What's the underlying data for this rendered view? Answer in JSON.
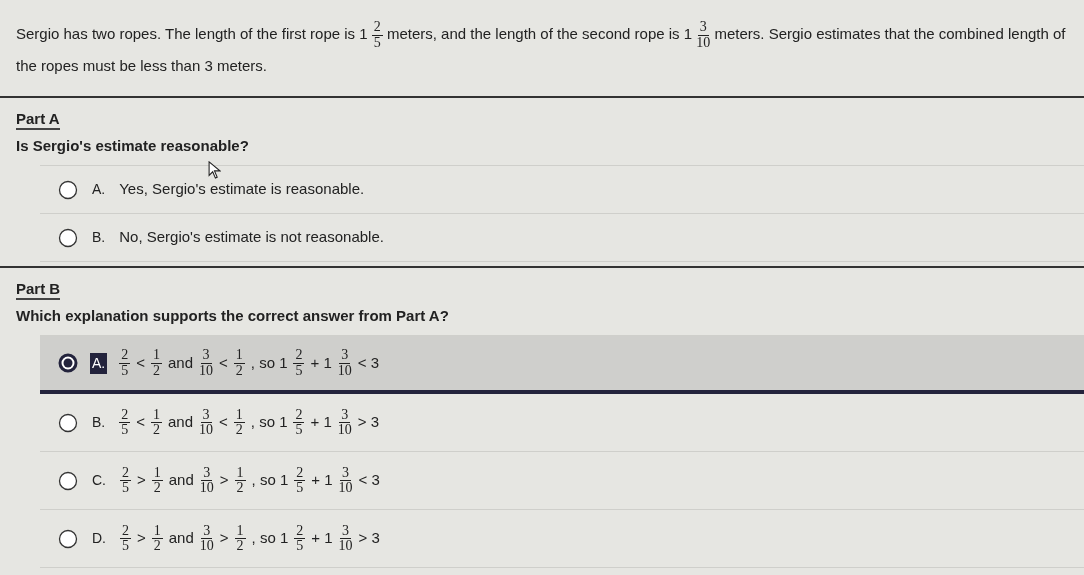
{
  "stem": [
    {
      "kind": "text",
      "text": "Sergio has two ropes. The length of the first rope is"
    },
    {
      "kind": "text",
      "text": "1"
    },
    {
      "kind": "frac",
      "num": "2",
      "den": "5"
    },
    {
      "kind": "text",
      "text": "meters, and the length of the second rope is"
    },
    {
      "kind": "text",
      "text": "1"
    },
    {
      "kind": "frac",
      "num": "3",
      "den": "10"
    },
    {
      "kind": "text",
      "text": "meters. Sergio estimates that the combined length of the ropes must be less than 3 meters."
    }
  ],
  "parts": [
    {
      "title": "Part A",
      "prompt": "Is Sergio's estimate reasonable?",
      "options": [
        {
          "letter": "A.",
          "selected": false,
          "content": [
            {
              "kind": "text",
              "text": "Yes, Sergio's estimate is reasonable."
            }
          ]
        },
        {
          "letter": "B.",
          "selected": false,
          "content": [
            {
              "kind": "text",
              "text": "No, Sergio's estimate is not reasonable."
            }
          ]
        }
      ]
    },
    {
      "title": "Part B",
      "prompt": "Which explanation supports the correct answer from Part A?",
      "options": [
        {
          "letter": "A.",
          "selected": true,
          "content": [
            {
              "kind": "frac",
              "num": "2",
              "den": "5"
            },
            {
              "kind": "text",
              "text": "<"
            },
            {
              "kind": "frac",
              "num": "1",
              "den": "2"
            },
            {
              "kind": "text",
              "text": "and"
            },
            {
              "kind": "frac",
              "num": "3",
              "den": "10"
            },
            {
              "kind": "text",
              "text": "<"
            },
            {
              "kind": "frac",
              "num": "1",
              "den": "2"
            },
            {
              "kind": "text",
              "text": ", so 1"
            },
            {
              "kind": "frac",
              "num": "2",
              "den": "5"
            },
            {
              "kind": "text",
              "text": "+ 1"
            },
            {
              "kind": "frac",
              "num": "3",
              "den": "10"
            },
            {
              "kind": "text",
              "text": "< 3"
            }
          ]
        },
        {
          "letter": "B.",
          "selected": false,
          "content": [
            {
              "kind": "frac",
              "num": "2",
              "den": "5"
            },
            {
              "kind": "text",
              "text": "<"
            },
            {
              "kind": "frac",
              "num": "1",
              "den": "2"
            },
            {
              "kind": "text",
              "text": "and"
            },
            {
              "kind": "frac",
              "num": "3",
              "den": "10"
            },
            {
              "kind": "text",
              "text": "<"
            },
            {
              "kind": "frac",
              "num": "1",
              "den": "2"
            },
            {
              "kind": "text",
              "text": ", so 1"
            },
            {
              "kind": "frac",
              "num": "2",
              "den": "5"
            },
            {
              "kind": "text",
              "text": "+ 1"
            },
            {
              "kind": "frac",
              "num": "3",
              "den": "10"
            },
            {
              "kind": "text",
              "text": "> 3"
            }
          ]
        },
        {
          "letter": "C.",
          "selected": false,
          "content": [
            {
              "kind": "frac",
              "num": "2",
              "den": "5"
            },
            {
              "kind": "text",
              "text": ">"
            },
            {
              "kind": "frac",
              "num": "1",
              "den": "2"
            },
            {
              "kind": "text",
              "text": "and"
            },
            {
              "kind": "frac",
              "num": "3",
              "den": "10"
            },
            {
              "kind": "text",
              "text": ">"
            },
            {
              "kind": "frac",
              "num": "1",
              "den": "2"
            },
            {
              "kind": "text",
              "text": ", so 1"
            },
            {
              "kind": "frac",
              "num": "2",
              "den": "5"
            },
            {
              "kind": "text",
              "text": "+ 1"
            },
            {
              "kind": "frac",
              "num": "3",
              "den": "10"
            },
            {
              "kind": "text",
              "text": "< 3"
            }
          ]
        },
        {
          "letter": "D.",
          "selected": false,
          "content": [
            {
              "kind": "frac",
              "num": "2",
              "den": "5"
            },
            {
              "kind": "text",
              "text": ">"
            },
            {
              "kind": "frac",
              "num": "1",
              "den": "2"
            },
            {
              "kind": "text",
              "text": "and"
            },
            {
              "kind": "frac",
              "num": "3",
              "den": "10"
            },
            {
              "kind": "text",
              "text": ">"
            },
            {
              "kind": "frac",
              "num": "1",
              "den": "2"
            },
            {
              "kind": "text",
              "text": ", so 1"
            },
            {
              "kind": "frac",
              "num": "2",
              "den": "5"
            },
            {
              "kind": "text",
              "text": "+ 1"
            },
            {
              "kind": "frac",
              "num": "3",
              "den": "10"
            },
            {
              "kind": "text",
              "text": "> 3"
            }
          ]
        }
      ]
    }
  ]
}
